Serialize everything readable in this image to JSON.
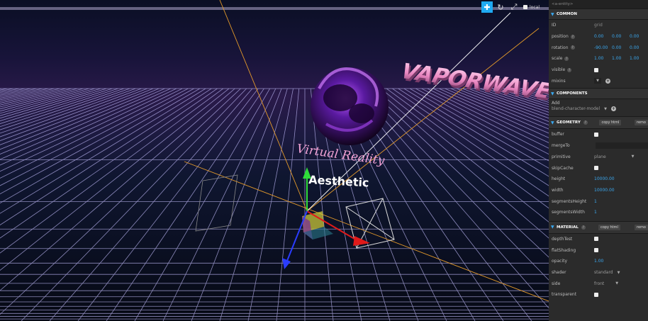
{
  "scene": {
    "knot_color": "#5a1aa0",
    "vaporwave_text": "VAPORWAVE",
    "virtual_reality_text": "Virtual Reality",
    "aesthetic_text": "Aesthetic"
  },
  "toolbar": {
    "local_label": "local"
  },
  "inspector": {
    "entity_label": "<a-entity>",
    "common": {
      "title": "COMMON",
      "id_label": "ID",
      "id_value": "grid",
      "position_label": "position",
      "position": [
        "0.00",
        "0.00",
        "0.00"
      ],
      "rotation_label": "rotation",
      "rotation": [
        "-90.00",
        "0.00",
        "0.00"
      ],
      "scale_label": "scale",
      "scale": [
        "1.00",
        "1.00",
        "1.00"
      ],
      "visible_label": "visible",
      "mixins_label": "mixins"
    },
    "components": {
      "title": "COMPONENTS",
      "add_label": "Add",
      "add_value": "blend-character-model"
    },
    "geometry": {
      "title": "GEOMETRY",
      "copy_label": "copy html",
      "remove_label": "remo",
      "buffer_label": "buffer",
      "mergeto_label": "mergeTo",
      "primitive_label": "primitive",
      "primitive_value": "plane",
      "skipcache_label": "skipCache",
      "height_label": "height",
      "height_value": "10000.00",
      "width_label": "width",
      "width_value": "10000.00",
      "segh_label": "segmentsHeight",
      "segh_value": "1",
      "segw_label": "segmentsWidth",
      "segw_value": "1"
    },
    "material": {
      "title": "MATERIAL",
      "copy_label": "copy html",
      "remove_label": "remo",
      "depthtest_label": "depthTest",
      "flatshading_label": "flatShading",
      "opacity_label": "opacity",
      "opacity_value": "1.00",
      "shader_label": "shader",
      "shader_value": "standard",
      "side_label": "side",
      "side_value": "front",
      "transparent_label": "transparent"
    }
  }
}
